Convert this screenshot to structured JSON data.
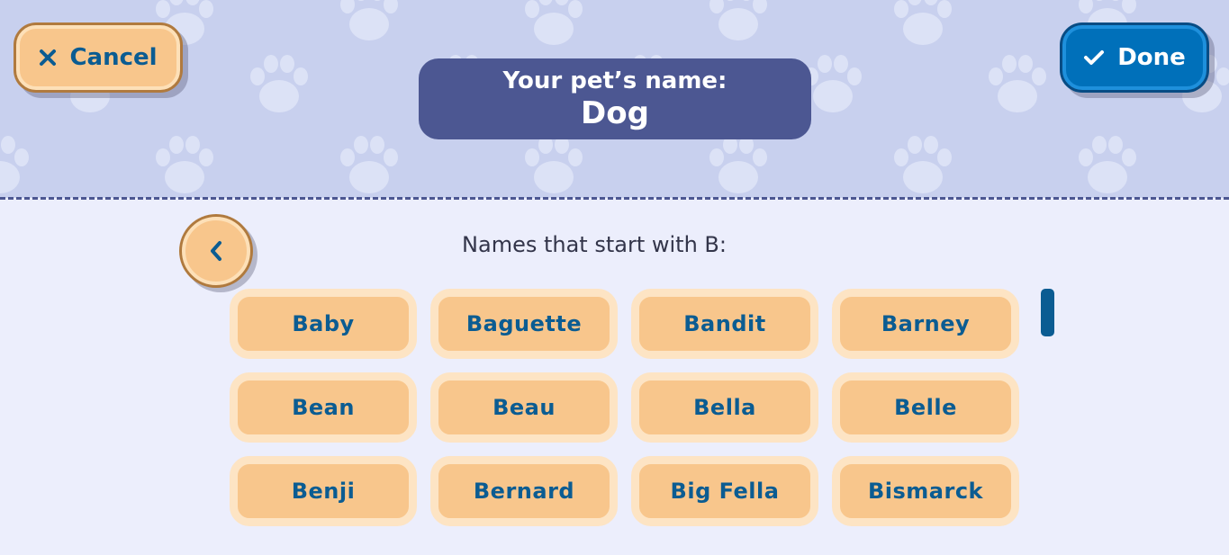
{
  "header": {
    "cancel_label": "Cancel",
    "done_label": "Done",
    "name_prompt": "Your pet’s name:",
    "name_value": "Dog"
  },
  "list": {
    "subtitle": "Names that start with B:",
    "names": [
      "Baby",
      "Baguette",
      "Bandit",
      "Barney",
      "Bean",
      "Beau",
      "Bella",
      "Belle",
      "Benji",
      "Bernard",
      "Big Fella",
      "Bismarck"
    ]
  },
  "icons": {
    "cancel": "close-icon",
    "done": "check-icon",
    "back": "chevron-left-icon",
    "background": "paw-print-icon"
  },
  "colors": {
    "header_bg": "#C8D0EE",
    "page_bg": "#ECEEFC",
    "name_box": "#4C5792",
    "chip": "#F8C68C",
    "text_blue": "#0B5C92",
    "done_button": "#0070BA"
  }
}
